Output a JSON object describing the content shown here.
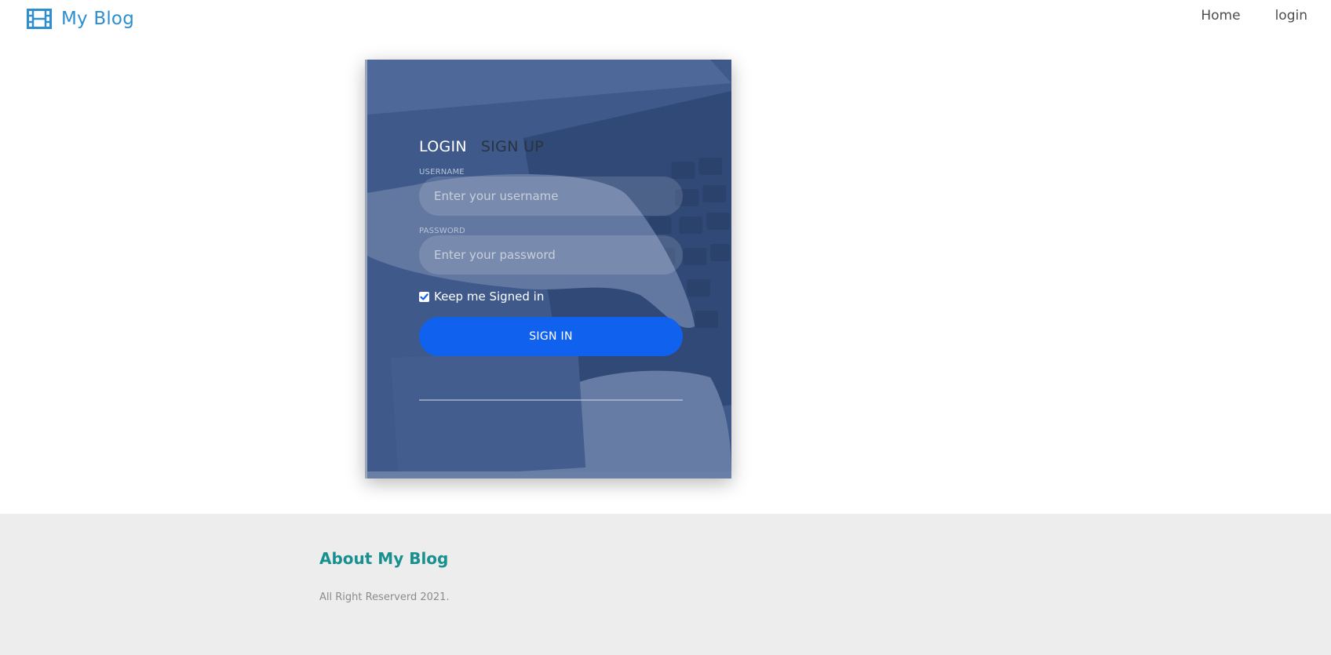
{
  "navbar": {
    "brand": "My Blog",
    "brand_icon": "film-icon",
    "links": [
      "Home",
      "login"
    ]
  },
  "login": {
    "tabs": [
      "LOGIN",
      "SIGN UP"
    ],
    "username_label": "USERNAME",
    "username_placeholder": "Enter your username",
    "password_label": "PASSWORD",
    "password_placeholder": "Enter your password",
    "keep_signed_in": "Keep me Signed in",
    "keep_signed_in_checked": true,
    "signin_label": "SIGN IN"
  },
  "footer": {
    "title": "About My Blog",
    "copyright": "All Right Reserverd 2021."
  },
  "colors": {
    "brand": "#2e8fd0",
    "signin_button": "#1061ee",
    "footer_title": "#17908f",
    "footer_bg": "#ededed"
  }
}
